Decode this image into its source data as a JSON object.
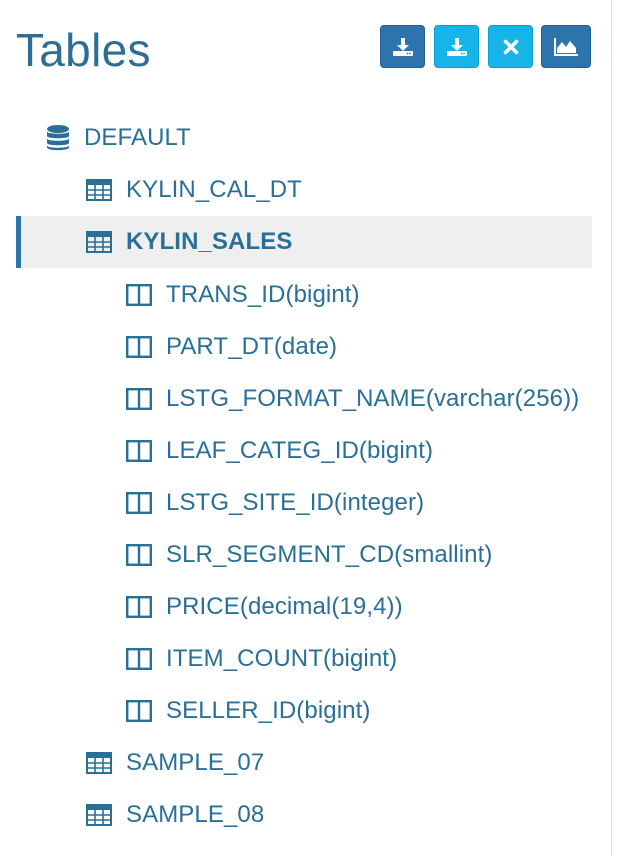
{
  "header": {
    "title": "Tables"
  },
  "toolbar": {
    "buttons": [
      {
        "name": "load-table-button",
        "icon": "download-tray-icon",
        "style": "dark"
      },
      {
        "name": "load-hive-table-button",
        "icon": "download-tray-icon",
        "style": "light"
      },
      {
        "name": "unload-table-button",
        "icon": "close-icon",
        "style": "light"
      },
      {
        "name": "chart-button",
        "icon": "area-chart-icon",
        "style": "dark"
      }
    ]
  },
  "tree": {
    "database": {
      "label": "DEFAULT",
      "icon": "database-icon"
    },
    "tables": [
      {
        "label": "KYLIN_CAL_DT",
        "icon": "table-icon",
        "selected": false
      },
      {
        "label": "KYLIN_SALES",
        "icon": "table-icon",
        "selected": true,
        "columns": [
          {
            "label": "TRANS_ID(bigint)",
            "icon": "column-icon"
          },
          {
            "label": "PART_DT(date)",
            "icon": "column-icon"
          },
          {
            "label": "LSTG_FORMAT_NAME(varchar(256))",
            "icon": "column-icon"
          },
          {
            "label": "LEAF_CATEG_ID(bigint)",
            "icon": "column-icon"
          },
          {
            "label": "LSTG_SITE_ID(integer)",
            "icon": "column-icon"
          },
          {
            "label": "SLR_SEGMENT_CD(smallint)",
            "icon": "column-icon"
          },
          {
            "label": "PRICE(decimal(19,4))",
            "icon": "column-icon"
          },
          {
            "label": "ITEM_COUNT(bigint)",
            "icon": "column-icon"
          },
          {
            "label": "SELLER_ID(bigint)",
            "icon": "column-icon"
          }
        ]
      },
      {
        "label": "SAMPLE_07",
        "icon": "table-icon",
        "selected": false
      },
      {
        "label": "SAMPLE_08",
        "icon": "table-icon",
        "selected": false
      }
    ]
  },
  "colors": {
    "text": "#2a6f97",
    "button_dark": "#2d74ad",
    "button_light": "#17b4ea",
    "selected_bg": "#efefef"
  }
}
